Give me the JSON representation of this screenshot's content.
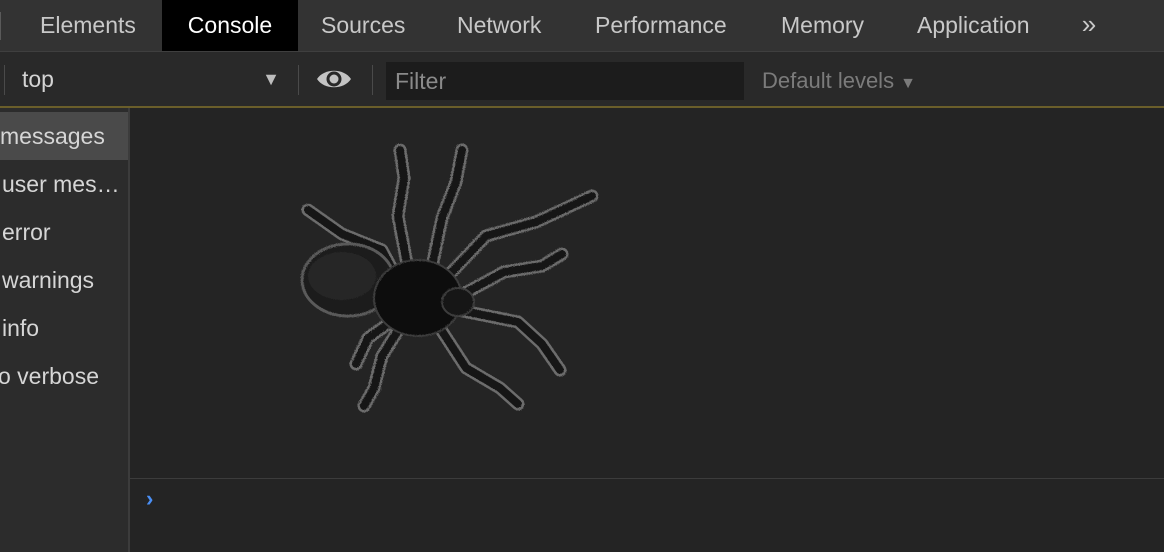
{
  "tabs": {
    "items": [
      {
        "label": "Elements",
        "active": false
      },
      {
        "label": "Console",
        "active": true
      },
      {
        "label": "Sources",
        "active": false
      },
      {
        "label": "Network",
        "active": false
      },
      {
        "label": "Performance",
        "active": false
      },
      {
        "label": "Memory",
        "active": false
      },
      {
        "label": "Application",
        "active": false
      }
    ],
    "more_glyph": "»"
  },
  "toolbar": {
    "context": "top",
    "context_arrow": "▼",
    "filter_placeholder": "Filter",
    "filter_value": "",
    "levels_label": "Default levels",
    "levels_arrow": "▼"
  },
  "sidebar": {
    "items": [
      {
        "label": "messages",
        "selected": true
      },
      {
        "label": "user mes…",
        "selected": false
      },
      {
        "label": "error",
        "selected": false
      },
      {
        "label": "warnings",
        "selected": false
      },
      {
        "label": "info",
        "selected": false
      },
      {
        "label": "o verbose",
        "selected": false
      }
    ]
  },
  "console": {
    "image": "tarantula-image",
    "prompt_glyph": "›"
  },
  "colors": {
    "active_tab_bg": "#000000",
    "prompt_caret": "#4a8ff5",
    "toolbar_accent_line": "#6a5e2a"
  }
}
